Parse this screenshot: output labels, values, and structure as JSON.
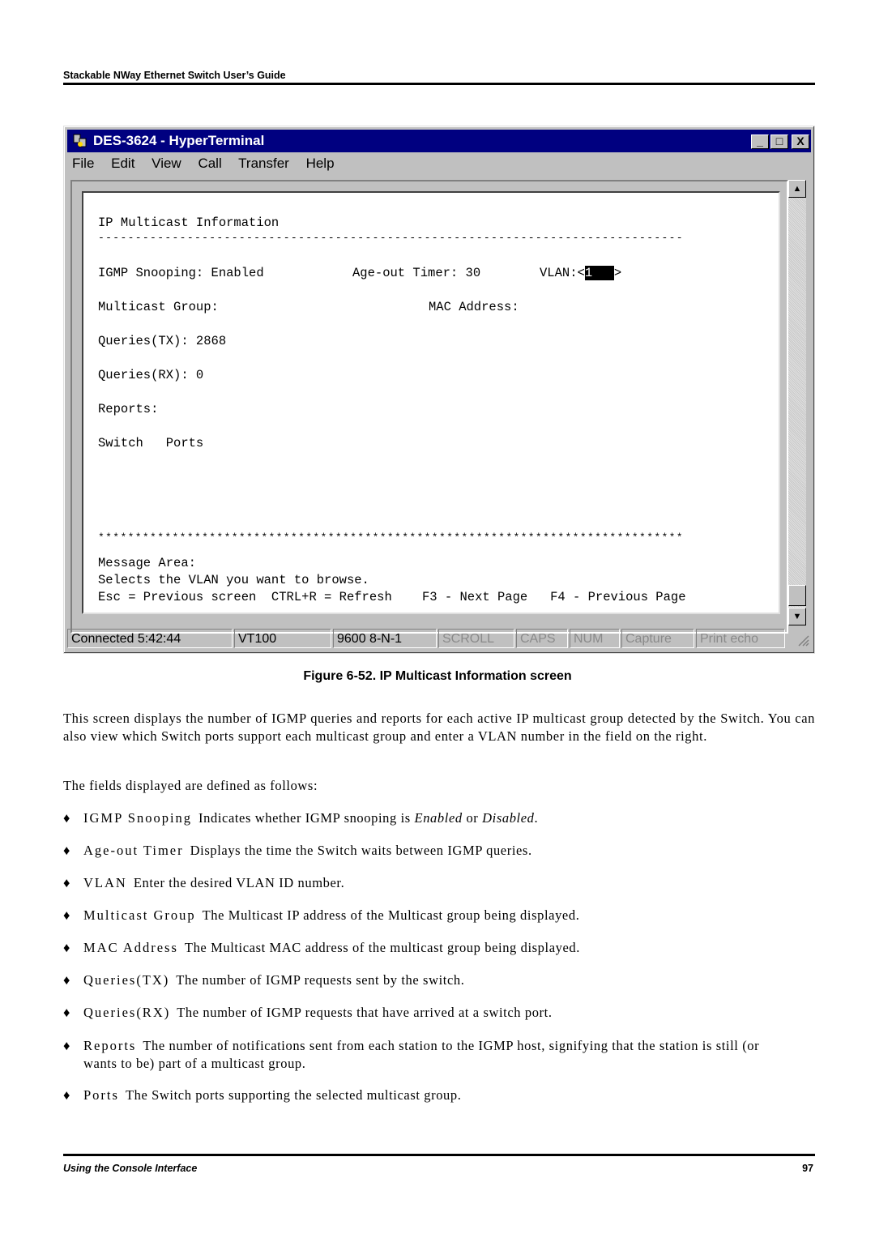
{
  "page_header": "Stackable NWay Ethernet Switch User’s Guide",
  "window": {
    "title": "DES-3624 - HyperTerminal",
    "controls": {
      "minimize": "_",
      "maximize": "□",
      "close": "X"
    },
    "menu": [
      "File",
      "Edit",
      "View",
      "Call",
      "Transfer",
      "Help"
    ]
  },
  "terminal": {
    "heading": "IP Multicast Information",
    "dash_rule": "-------------------------------------------------------------------------------",
    "igmp_label": "IGMP Snooping: Enabled",
    "age_label": "Age-out Timer: 30",
    "vlan_label": "VLAN:<",
    "vlan_value": "1",
    "vlan_close": ">",
    "multicast_group": "Multicast Group:",
    "mac_address": "MAC Address:",
    "queries_tx": "Queries(TX): 2868",
    "queries_rx": "Queries(RX): 0",
    "reports": "Reports:",
    "switch_ports": "Switch   Ports",
    "star_rule": "*******************************************************************************",
    "message_area": "Message Area:",
    "message": "Selects the VLAN you want to browse.",
    "keys": "Esc = Previous screen  CTRL+R = Refresh    F3 - Next Page   F4 - Previous Page"
  },
  "statusbar": [
    "Connected 5:42:44",
    "VT100",
    "9600 8-N-1",
    "SCROLL",
    "CAPS",
    "NUM",
    "Capture",
    "Print echo"
  ],
  "caption": "Figure 6-52.  IP Multicast Information screen",
  "intro": "This screen displays the number of IGMP queries and reports for each active IP multicast group detected by the Switch. You can also view which Switch ports support each multicast group and enter a VLAN number in the field on the right.",
  "fields_intro": "The fields displayed are defined as follows:",
  "bullet_symbol": "♦",
  "definitions": [
    {
      "term": "IGMP Snooping",
      "desc_pre": "Indicates whether IGMP snooping is ",
      "em1": "Enabled",
      "mid": " or ",
      "em2": "Disabled",
      "post": "."
    },
    {
      "term": "Age-out Timer",
      "desc": "Displays the time the Switch waits between IGMP queries."
    },
    {
      "term": "VLAN",
      "desc": "Enter the desired VLAN ID number."
    },
    {
      "term": "Multicast Group",
      "desc": "The Multicast IP address of the Multicast group being displayed."
    },
    {
      "term": "MAC Address",
      "desc": "The Multicast MAC address of the multicast group being displayed."
    },
    {
      "term": "Queries(TX)",
      "desc": "The number of IGMP requests sent by the switch."
    },
    {
      "term": "Queries(RX)",
      "desc": "The number of IGMP requests that have arrived at a switch port."
    },
    {
      "term": "Reports",
      "desc": "The number of notifications sent from each station to the IGMP host, signifying that the station is still (or wants to be) part of a multicast group."
    },
    {
      "term": "Ports",
      "desc": "The Switch ports supporting the selected multicast group."
    }
  ],
  "footer": {
    "section": "Using the Console Interface",
    "page": "97"
  }
}
